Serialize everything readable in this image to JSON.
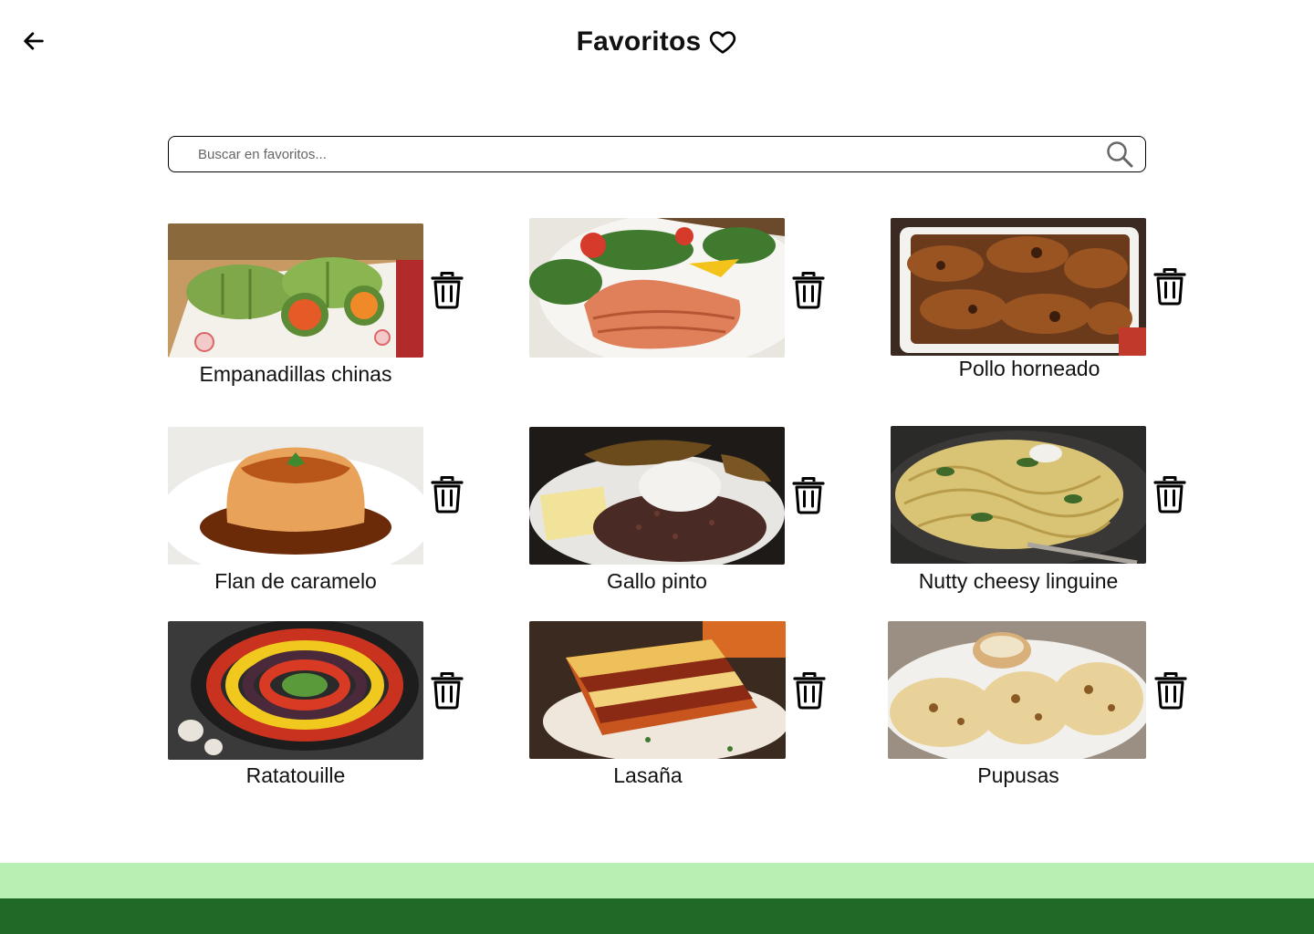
{
  "header": {
    "title": "Favoritos",
    "back_icon": "arrow-left-icon",
    "heart_icon": "heart-outline-icon"
  },
  "search": {
    "placeholder": "Buscar en favoritos...",
    "value": "",
    "icon": "search-icon"
  },
  "favorites": [
    {
      "name": "Empanadillas chinas",
      "image": "cucumber-wrapped-vegetable-rolls"
    },
    {
      "name": "",
      "image": "grilled-salmon-with-salad"
    },
    {
      "name": "Pollo horneado",
      "image": "baked-chicken-drumsticks"
    },
    {
      "name": "Flan de caramelo",
      "image": "caramel-flan"
    },
    {
      "name": "Gallo pinto",
      "image": "rice-and-beans-with-cream-and-plantain"
    },
    {
      "name": "Nutty cheesy linguine",
      "image": "spinach-cheese-linguine"
    },
    {
      "name": "Ratatouille",
      "image": "ratatouille-in-skillet"
    },
    {
      "name": "Lasaña",
      "image": "lasagna-slice"
    },
    {
      "name": "Pupusas",
      "image": "pupusas-with-curtido"
    }
  ],
  "delete_icon": "trash-icon",
  "colors": {
    "footer_light": "#b8f0b3",
    "footer_dark": "#1f6a27",
    "text": "#111111"
  }
}
